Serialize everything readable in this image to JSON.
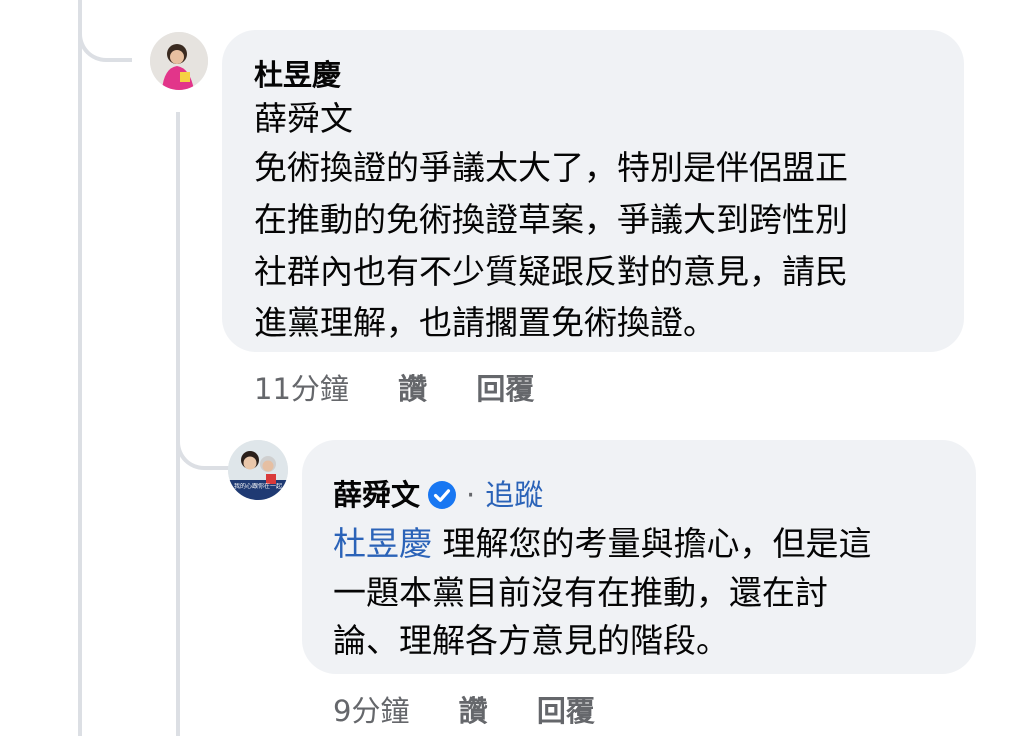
{
  "comment1": {
    "author": "杜昱慶",
    "mention": "薛舜文",
    "lines": [
      "免術換證的爭議太大了，特別是伴侶盟正",
      "在推動的免術換證草案，爭議大到跨性別",
      "社群內也有不少質疑跟反對的意見，請民",
      "進黨理解，也請擱置免術換證。"
    ],
    "time": "11分鐘",
    "like": "讚",
    "reply": "回覆"
  },
  "comment2": {
    "author": "薛舜文",
    "verified_icon": "verified-badge-icon",
    "separator": "·",
    "follow": "追蹤",
    "mention": "杜昱慶",
    "first_line_rest": " 理解您的考量與擔心，但是這",
    "lines": [
      "一題本黨目前沒有在推動，還在討",
      "論、理解各方意見的階段。"
    ],
    "avatar_text": "我的心跟你在一起",
    "time": "9分鐘",
    "like": "讚",
    "reply": "回覆"
  },
  "colors": {
    "bubble": "#f0f2f5",
    "link": "#2b63b8",
    "meta": "#65676b",
    "thread_line": "#dcdfe4",
    "verified": "#1877f2"
  }
}
